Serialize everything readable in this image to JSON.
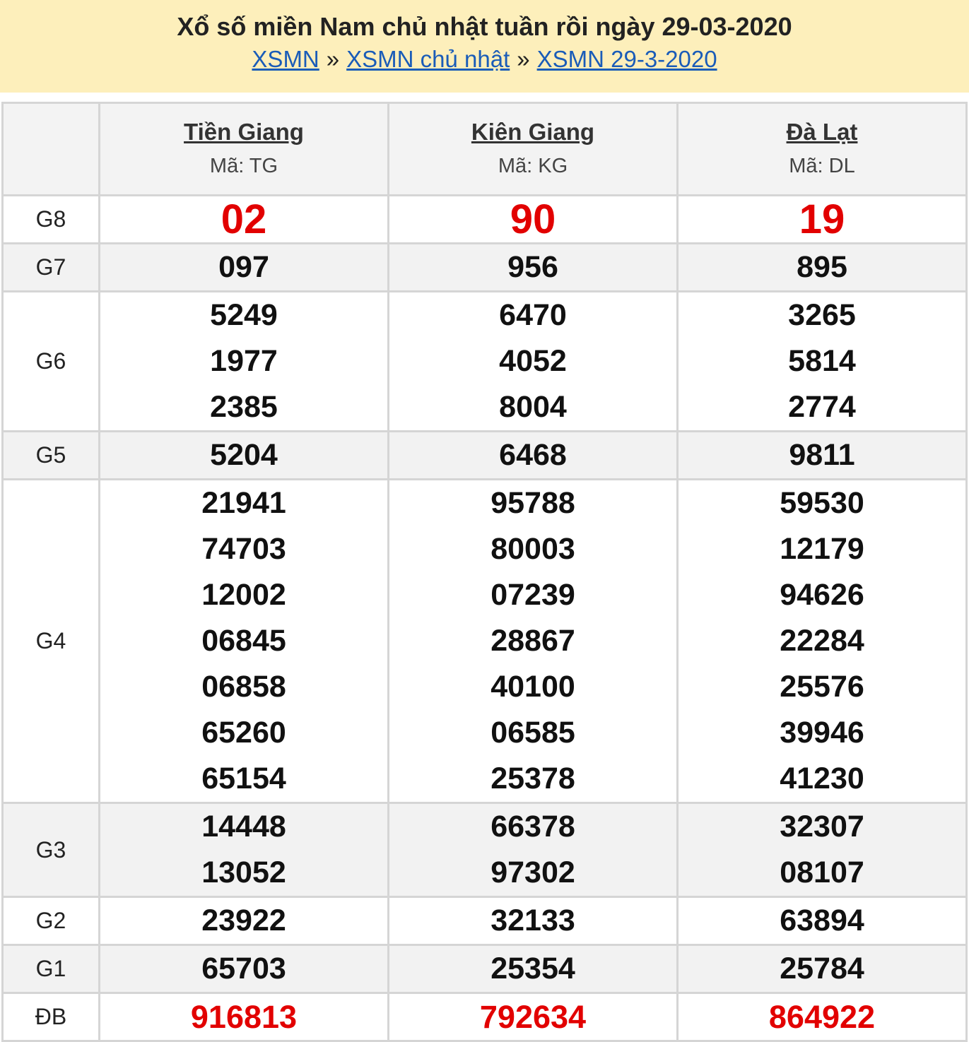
{
  "header": {
    "title": "Xổ số miền Nam chủ nhật tuần rồi ngày 29-03-2020",
    "breadcrumb": [
      {
        "label": "XSMN"
      },
      {
        "label": "XSMN chủ nhật"
      },
      {
        "label": "XSMN 29-3-2020"
      }
    ],
    "separator": "»"
  },
  "provinces": [
    {
      "name": "Tiền Giang",
      "code": "Mã: TG"
    },
    {
      "name": "Kiên Giang",
      "code": "Mã: KG"
    },
    {
      "name": "Đà Lạt",
      "code": "Mã: DL"
    }
  ],
  "prizes": {
    "g8": {
      "label": "G8",
      "values": [
        [
          "02"
        ],
        [
          "90"
        ],
        [
          "19"
        ]
      ]
    },
    "g7": {
      "label": "G7",
      "values": [
        [
          "097"
        ],
        [
          "956"
        ],
        [
          "895"
        ]
      ]
    },
    "g6": {
      "label": "G6",
      "values": [
        [
          "5249",
          "1977",
          "2385"
        ],
        [
          "6470",
          "4052",
          "8004"
        ],
        [
          "3265",
          "5814",
          "2774"
        ]
      ]
    },
    "g5": {
      "label": "G5",
      "values": [
        [
          "5204"
        ],
        [
          "6468"
        ],
        [
          "9811"
        ]
      ]
    },
    "g4": {
      "label": "G4",
      "values": [
        [
          "21941",
          "74703",
          "12002",
          "06845",
          "06858",
          "65260",
          "65154"
        ],
        [
          "95788",
          "80003",
          "07239",
          "28867",
          "40100",
          "06585",
          "25378"
        ],
        [
          "59530",
          "12179",
          "94626",
          "22284",
          "25576",
          "39946",
          "41230"
        ]
      ]
    },
    "g3": {
      "label": "G3",
      "values": [
        [
          "14448",
          "13052"
        ],
        [
          "66378",
          "97302"
        ],
        [
          "32307",
          "08107"
        ]
      ]
    },
    "g2": {
      "label": "G2",
      "values": [
        [
          "23922"
        ],
        [
          "32133"
        ],
        [
          "63894"
        ]
      ]
    },
    "g1": {
      "label": "G1",
      "values": [
        [
          "65703"
        ],
        [
          "25354"
        ],
        [
          "25784"
        ]
      ]
    },
    "db": {
      "label": "ĐB",
      "values": [
        [
          "916813"
        ],
        [
          "792634"
        ],
        [
          "864922"
        ]
      ]
    }
  },
  "colors": {
    "header_bg": "#fdefbb",
    "link": "#1a5cb8",
    "highlight_red": "#e20000",
    "alt_row": "#f2f2f2",
    "border": "#d5d5d5"
  }
}
